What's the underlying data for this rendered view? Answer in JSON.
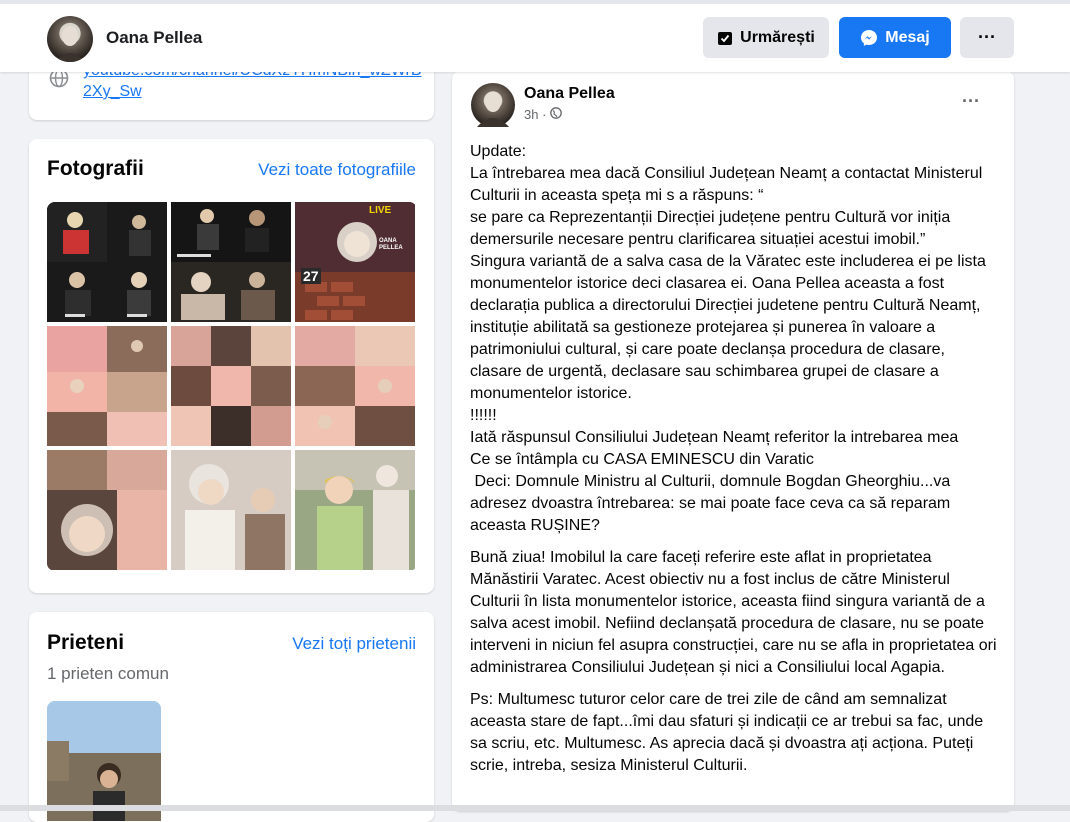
{
  "header": {
    "name": "Oana Pellea",
    "follow_label": "Urmărești",
    "message_label": "Mesaj",
    "more_label": "···"
  },
  "links": {
    "url": "youtube.com/channel/UCdXzYHmNBin_wZWrB2Xy_Sw"
  },
  "photos": {
    "title": "Fotografii",
    "see_all": "Vezi toate fotografiile",
    "live_text": "LIVE",
    "poster_name": "OANA PELLEA",
    "poster_date": "27"
  },
  "friends": {
    "title": "Prieteni",
    "see_all": "Vezi toți prietenii",
    "mutual": "1 prieten comun"
  },
  "post": {
    "author": "Oana Pellea",
    "time": "3h ·",
    "more": "···",
    "paragraphs": [
      "Update:\nLa întrebarea mea dacă Consiliul Județean Neamț a contactat Ministerul Culturii in aceasta speța mi s a răspuns: “\nse pare ca Reprezentanții Direcției județene pentru Cultură vor iniția demersurile necesare pentru clarificarea situației acestui imobil.”\nSingura variantă de a salva casa de la Văratec este includerea ei pe lista monumentelor istorice deci clasarea ei. Oana Pellea aceasta a fost declarația publica a directorului Direcției judetene pentru Cultură Neamț, instituție abilitată sa gestioneze protejarea și punerea în valoare a patrimoniului cultural, și care poate declanșa procedura de clasare, clasare de urgentă, declasare sau schimbarea grupei de clasare a monumentelor istorice.\n!!!!!!\nIată răspunsul Consiliului Județean Neamț referitor la intrebarea mea\nCe se întâmpla cu CASA EMINESCU din Varatic\n Deci: Domnule Ministru al Culturii, domnule Bogdan Gheorghiu...va adresez dvoastra întrebarea: se mai poate face ceva ca să reparam aceasta RUȘINE?",
      "Bună ziua! Imobilul la care faceți referire este aflat in proprietatea Mănăstirii Varatec. Acest obiectiv nu a fost inclus de către Ministerul Culturii în lista monumentelor istorice, aceasta fiind singura variantă de a salva acest imobil. Nefiind declanșată procedura de clasare, nu se poate interveni in niciun fel asupra construcției, care nu se afla in proprietatea ori administrarea Consiliului Județean și nici a Consiliului local Agapia.",
      "Ps: Multumesc tuturor celor care de trei zile de când am semnalizat aceasta stare de fapt...îmi dau sfaturi și indicații ce ar trebui sa fac, unde sa scriu, etc. Multumesc. As aprecia dacă și dvoastra ați acționa. Puteți scrie, intreba, sesiza Ministerul Culturii."
    ]
  },
  "colors": {
    "accent": "#1877f2",
    "background": "#f0f2f5",
    "secondary_text": "#65676b"
  },
  "icons": [
    "follow-check-icon",
    "messenger-icon",
    "globe-icon",
    "public-globe-icon",
    "more-dots-icon"
  ]
}
